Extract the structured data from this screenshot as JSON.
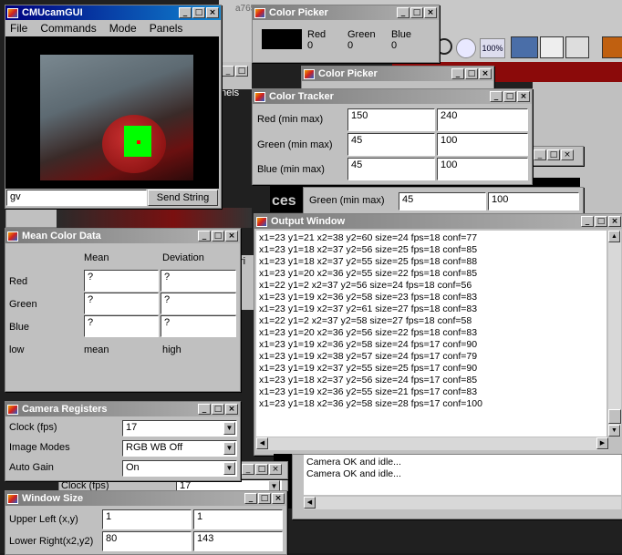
{
  "cmucam": {
    "title": "CMUcamGUI",
    "menu": [
      "File",
      "Commands",
      "Mode",
      "Panels"
    ],
    "input_value": "gv",
    "send_button": "Send String"
  },
  "bg_texts": {
    "peek1": "a765",
    "peek2": "nels",
    "peek3": "ces",
    "peek4": "Clock (fps)",
    "peek5": "17",
    "peek6": "n",
    "peek7": "ri",
    "zoom_label": "100%"
  },
  "color_picker_front": {
    "title": "Color Picker",
    "cols": [
      "Red",
      "Green",
      "Blue"
    ],
    "vals": [
      "0",
      "0",
      "0"
    ]
  },
  "color_picker_back": {
    "title": "Color Picker"
  },
  "color_tracker": {
    "title": "Color Tracker",
    "rows": [
      {
        "label": "Red (min max)",
        "min": "150",
        "max": "240"
      },
      {
        "label": "Green (min max)",
        "min": "45",
        "max": "100"
      },
      {
        "label": "Blue (min max)",
        "min": "45",
        "max": "100"
      }
    ]
  },
  "behind_green": {
    "label": "Green (min max)",
    "min": "45",
    "max": "100"
  },
  "output": {
    "title": "Output Window",
    "lines": [
      "x1=23 y1=21 x2=38 y2=60 size=24 fps=18 conf=77",
      "x1=23 y1=18 x2=37 y2=56 size=25 fps=18 conf=85",
      "x1=23 y1=18 x2=37 y2=55 size=25 fps=18 conf=88",
      "x1=23 y1=20 x2=36 y2=55 size=22 fps=18 conf=85",
      "x1=22 y1=2 x2=37 y2=56 size=24 fps=18 conf=56",
      "x1=23 y1=19 x2=36 y2=58 size=23 fps=18 conf=83",
      "x1=23 y1=19 x2=37 y2=61 size=27 fps=18 conf=83",
      "x1=22 y1=2 x2=37 y2=58 size=27 fps=18 conf=58",
      "x1=23 y1=20 x2=36 y2=56 size=22 fps=18 conf=83",
      "x1=23 y1=19 x2=36 y2=58 size=24 fps=17 conf=90",
      "x1=23 y1=19 x2=38 y2=57 size=24 fps=17 conf=79",
      "x1=23 y1=19 x2=37 y2=55 size=25 fps=17 conf=90",
      "x1=23 y1=18 x2=37 y2=56 size=24 fps=17 conf=85",
      "x1=23 y1=19 x2=36 y2=55 size=21 fps=17 conf=83",
      "x1=23 y1=18 x2=36 y2=58 size=28 fps=17 conf=100"
    ],
    "status_lines": [
      "Camera OK and idle...",
      "Camera OK and idle..."
    ]
  },
  "mean_color": {
    "title": "Mean Color Data",
    "headers": [
      "Mean",
      "Deviation"
    ],
    "rows": [
      {
        "label": "Red",
        "mean": "?",
        "dev": "?"
      },
      {
        "label": "Green",
        "mean": "?",
        "dev": "?"
      },
      {
        "label": "Blue",
        "mean": "?",
        "dev": "?"
      }
    ],
    "footer": [
      "low",
      "mean",
      "high"
    ]
  },
  "camera_registers": {
    "title": "Camera Registers",
    "rows": [
      {
        "label": "Clock (fps)",
        "value": "17"
      },
      {
        "label": "Image Modes",
        "value": "RGB WB Off"
      },
      {
        "label": "Auto Gain",
        "value": "On"
      }
    ],
    "partial_label": "Clock (fps)",
    "partial_value": "17"
  },
  "window_size": {
    "title": "Window Size",
    "rows": [
      {
        "label": "Upper Left (x,y)",
        "v1": "1",
        "v2": "1"
      },
      {
        "label": "Lower Right(x2,y2)",
        "v1": "80",
        "v2": "143"
      }
    ]
  }
}
